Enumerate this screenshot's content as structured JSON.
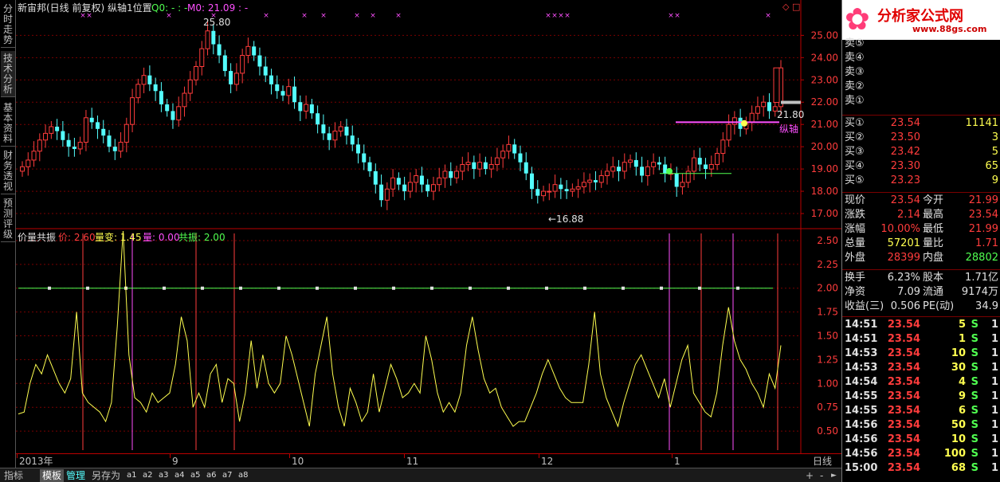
{
  "side_tabs": [
    "分时走势",
    "技术分析",
    "基本资料",
    "财务透视",
    "预测评级"
  ],
  "header": {
    "title": "新宙邦(日线 前复权) 纵轴1位置",
    "q0": "Q0: - : -",
    "m0": "M0: 21.09 : -"
  },
  "indicator_header": {
    "name": "价量共振",
    "price": "价: 2.60",
    "volchange": "量变: 1.45",
    "vol": "量: 0.00",
    "resonance": "共振: 2.00"
  },
  "annotations": {
    "high": "25.80",
    "low": "←16.88",
    "last": "21.80",
    "axis_label": "纵轴"
  },
  "price_axis": [
    "25.00",
    "24.00",
    "23.00",
    "22.00",
    "21.00",
    "20.00",
    "19.00",
    "18.00",
    "17.00"
  ],
  "ind_axis": [
    "2.50",
    "2.25",
    "2.00",
    "1.75",
    "1.50",
    "1.25",
    "1.00",
    "0.75",
    "0.50"
  ],
  "date_axis": [
    "2013年",
    "9",
    "10",
    "11",
    "12",
    "1"
  ],
  "period": "日线",
  "bottom_tabs": [
    "指标",
    "模板",
    "管理",
    "另存为",
    "a1",
    "a2",
    "a3",
    "a4",
    "a5",
    "a6",
    "a7",
    "a8"
  ],
  "logo": {
    "text": "分析家公式网",
    "url": "www.88gs.com"
  },
  "quote": {
    "sell": [
      {
        "label": "卖⑤"
      },
      {
        "label": "卖④"
      },
      {
        "label": "卖③"
      },
      {
        "label": "卖②"
      },
      {
        "label": "卖①"
      }
    ],
    "buy": [
      {
        "label": "买①",
        "price": "23.54",
        "vol": "11141"
      },
      {
        "label": "买②",
        "price": "23.50",
        "vol": "3"
      },
      {
        "label": "买③",
        "price": "23.42",
        "vol": "5"
      },
      {
        "label": "买④",
        "price": "23.30",
        "vol": "65"
      },
      {
        "label": "买⑤",
        "price": "23.23",
        "vol": "9"
      }
    ],
    "stats": [
      {
        "l1": "现价",
        "v1": "23.54",
        "l2": "今开",
        "v2": "21.99"
      },
      {
        "l1": "涨跌",
        "v1": "2.14",
        "l2": "最高",
        "v2": "23.54"
      },
      {
        "l1": "涨幅",
        "v1": "10.00%",
        "l2": "最低",
        "v2": "21.99"
      },
      {
        "l1": "总量",
        "v1": "57201",
        "l2": "量比",
        "v2": "1.71"
      },
      {
        "l1": "外盘",
        "v1": "28399",
        "l2": "内盘",
        "v2": "28802"
      }
    ],
    "info": [
      {
        "l1": "换手",
        "v1": "6.23%",
        "l2": "股本",
        "v2": "1.71亿"
      },
      {
        "l1": "净资",
        "v1": "7.09",
        "l2": "流通",
        "v2": "9174万"
      },
      {
        "l1": "收益(三)",
        "v1": "0.506",
        "l2": "PE(动)",
        "v2": "34.9"
      }
    ],
    "ticks": [
      {
        "t": "14:51",
        "p": "23.54",
        "v": "5",
        "s": "S",
        "n": "1"
      },
      {
        "t": "14:51",
        "p": "23.54",
        "v": "1",
        "s": "S",
        "n": "1"
      },
      {
        "t": "14:53",
        "p": "23.54",
        "v": "10",
        "s": "S",
        "n": "1"
      },
      {
        "t": "14:53",
        "p": "23.54",
        "v": "30",
        "s": "S",
        "n": "1"
      },
      {
        "t": "14:54",
        "p": "23.54",
        "v": "4",
        "s": "S",
        "n": "1"
      },
      {
        "t": "14:55",
        "p": "23.54",
        "v": "9",
        "s": "S",
        "n": "1"
      },
      {
        "t": "14:55",
        "p": "23.54",
        "v": "6",
        "s": "S",
        "n": "1"
      },
      {
        "t": "14:56",
        "p": "23.54",
        "v": "50",
        "s": "S",
        "n": "1"
      },
      {
        "t": "14:56",
        "p": "23.54",
        "v": "10",
        "s": "S",
        "n": "1"
      },
      {
        "t": "14:56",
        "p": "23.54",
        "v": "100",
        "s": "S",
        "n": "1"
      },
      {
        "t": "15:00",
        "p": "23.54",
        "v": "68",
        "s": "S",
        "n": "1"
      }
    ]
  },
  "colors": {
    "up": "#ff3c3c",
    "down": "#54ffff",
    "grid": "#7a0000",
    "yellow": "#ffff50",
    "magenta": "#ff50ff",
    "green": "#50ff50"
  },
  "chart_data": {
    "type": "candlestick",
    "price_range": [
      16.5,
      25.8
    ],
    "indicator_range": [
      0.3,
      2.6
    ],
    "closes": [
      19.1,
      19.4,
      19.8,
      20.3,
      20.6,
      20.9,
      20.7,
      20.3,
      20.0,
      19.9,
      20.2,
      21.3,
      21.1,
      20.8,
      20.5,
      20.0,
      19.8,
      20.2,
      21.0,
      22.2,
      22.8,
      23.2,
      22.8,
      22.5,
      21.9,
      21.6,
      21.2,
      21.8,
      22.4,
      23.0,
      23.6,
      24.4,
      25.2,
      24.6,
      24.1,
      23.4,
      22.8,
      23.3,
      24.1,
      24.5,
      24.1,
      23.6,
      23.2,
      22.8,
      22.5,
      22.3,
      22.7,
      22.0,
      21.6,
      21.9,
      21.5,
      21.0,
      20.6,
      20.3,
      20.7,
      20.9,
      20.5,
      20.1,
      19.7,
      19.3,
      18.9,
      18.3,
      17.6,
      18.1,
      18.6,
      18.3,
      18.0,
      18.4,
      18.7,
      18.3,
      18.0,
      18.3,
      18.6,
      18.9,
      18.6,
      18.9,
      19.2,
      19.3,
      19.0,
      19.3,
      19.0,
      19.2,
      19.5,
      19.8,
      20.1,
      19.7,
      19.3,
      18.8,
      18.1,
      17.8,
      18.0,
      18.0,
      18.3,
      18.1,
      18.0,
      18.1,
      18.2,
      18.4,
      18.5,
      18.4,
      18.7,
      18.9,
      19.1,
      18.9,
      19.3,
      19.4,
      19.1,
      18.7,
      19.1,
      19.3,
      19.2,
      18.8,
      18.8,
      18.2,
      18.4,
      18.9,
      19.5,
      19.2,
      19.0,
      19.2,
      19.7,
      20.3,
      21.0,
      21.3,
      20.8,
      21.1,
      21.5,
      21.8,
      22.0,
      21.6,
      21.8,
      23.54
    ],
    "indicator": [
      0.68,
      0.7,
      1.0,
      1.2,
      1.1,
      1.3,
      1.15,
      1.0,
      0.9,
      1.05,
      1.75,
      0.9,
      0.8,
      0.75,
      0.7,
      0.6,
      0.8,
      1.6,
      2.6,
      1.3,
      0.85,
      0.8,
      0.7,
      0.9,
      0.8,
      0.85,
      0.9,
      1.2,
      1.7,
      1.45,
      0.75,
      0.9,
      0.75,
      1.1,
      1.2,
      0.8,
      1.05,
      1.0,
      0.6,
      0.9,
      1.45,
      0.95,
      1.3,
      1.0,
      0.9,
      1.0,
      1.5,
      1.3,
      1.05,
      0.8,
      0.55,
      1.1,
      1.4,
      1.7,
      1.1,
      0.75,
      0.55,
      0.95,
      0.8,
      0.6,
      0.7,
      1.1,
      0.7,
      0.95,
      1.2,
      1.05,
      0.85,
      0.9,
      1.0,
      0.9,
      1.5,
      1.25,
      0.9,
      0.7,
      0.8,
      0.7,
      0.9,
      1.4,
      1.7,
      1.35,
      1.05,
      0.9,
      0.95,
      0.75,
      0.65,
      0.55,
      0.6,
      0.6,
      0.75,
      0.9,
      1.1,
      1.25,
      1.1,
      0.95,
      0.85,
      0.8,
      0.8,
      0.8,
      1.2,
      1.75,
      1.1,
      0.85,
      0.7,
      0.55,
      0.8,
      1.0,
      1.2,
      1.3,
      1.15,
      1.0,
      0.85,
      1.05,
      0.75,
      1.0,
      1.25,
      1.4,
      0.9,
      0.8,
      0.7,
      0.65,
      0.9,
      1.4,
      1.8,
      1.45,
      1.25,
      1.15,
      1.0,
      0.9,
      0.75,
      1.1,
      0.95,
      1.4
    ]
  }
}
